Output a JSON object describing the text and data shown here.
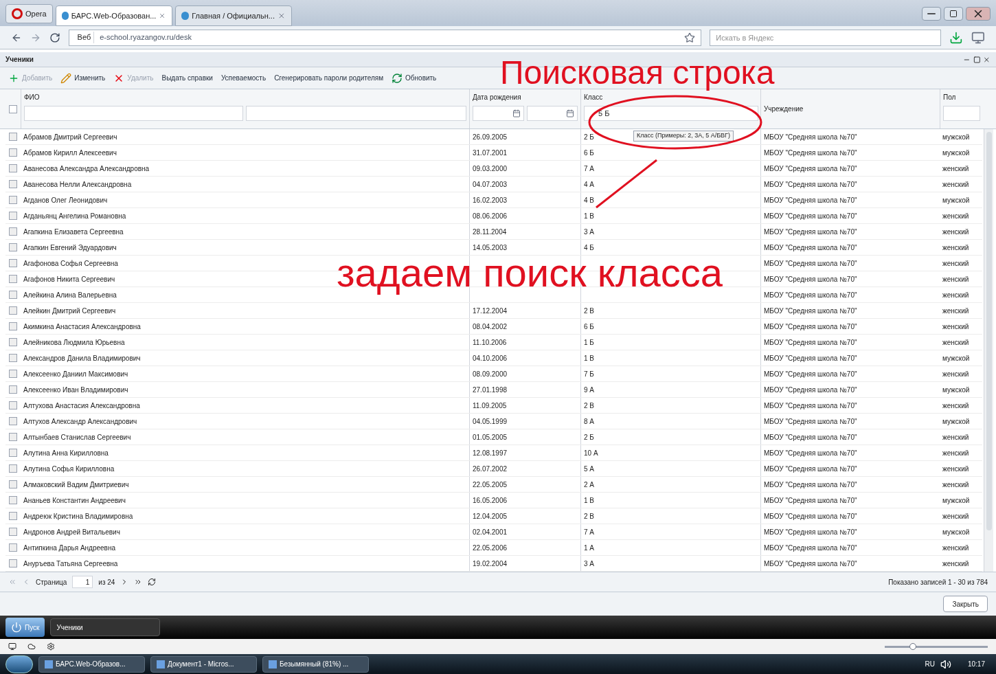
{
  "browser": {
    "menu_label": "Opera",
    "tabs": [
      {
        "label": "БАРС.Web-Образован...",
        "selected": true
      },
      {
        "label": "Главная / Официальн...",
        "selected": false
      }
    ],
    "address_badge": "Веб",
    "address": "e-school.ryazangov.ru/desk",
    "search_placeholder": "Искать в Яндекс"
  },
  "app": {
    "window_title": "Ученики",
    "toolbar": [
      {
        "label": "Добавить",
        "disabled": true,
        "kind": "add"
      },
      {
        "label": "Изменить",
        "disabled": false,
        "kind": "edit"
      },
      {
        "label": "Удалить",
        "disabled": true,
        "kind": "delete"
      },
      {
        "label": "Выдать справки",
        "disabled": false,
        "kind": "text"
      },
      {
        "label": "Успеваемость",
        "disabled": false,
        "kind": "text"
      },
      {
        "label": "Сгенерировать пароли родителям",
        "disabled": false,
        "kind": "text"
      },
      {
        "label": "Обновить",
        "disabled": false,
        "kind": "refresh"
      }
    ],
    "columns": [
      "ФИО",
      "Дата рождения",
      "Класс",
      "Учреждение",
      "Пол"
    ],
    "class_filter": "5 Б",
    "select_all": {
      "checked": false
    },
    "tooltip": "Класс (Примеры: 2, 3А, 5 А/БВГ)",
    "rows": [
      {
        "name": "Абрамов Дмитрий Сергеевич",
        "birth": "26.09.2005",
        "class": "2 Б",
        "school": "МБОУ \"Средняя школа №70\"",
        "sex": "мужской",
        "checked": false
      },
      {
        "name": "Абрамов Кирилл Алексеевич",
        "birth": "31.07.2001",
        "class": "6 Б",
        "school": "МБОУ \"Средняя школа №70\"",
        "sex": "мужской",
        "checked": false
      },
      {
        "name": "Аванесова Александра Александровна",
        "birth": "09.03.2000",
        "class": "7 А",
        "school": "МБОУ \"Средняя школа №70\"",
        "sex": "женский",
        "checked": false
      },
      {
        "name": "Аванесова Нелли Александровна",
        "birth": "04.07.2003",
        "class": "4 А",
        "school": "МБОУ \"Средняя школа №70\"",
        "sex": "женский",
        "checked": false
      },
      {
        "name": "Агданов Олег Леонидович",
        "birth": "16.02.2003",
        "class": "4 В",
        "school": "МБОУ \"Средняя школа №70\"",
        "sex": "мужской",
        "checked": false
      },
      {
        "name": "Агданьянц Ангелина Романовна",
        "birth": "08.06.2006",
        "class": "1 В",
        "school": "МБОУ \"Средняя школа №70\"",
        "sex": "женский",
        "checked": false
      },
      {
        "name": "Агапкина Елизавета Сергеевна",
        "birth": "28.11.2004",
        "class": "3 А",
        "school": "МБОУ \"Средняя школа №70\"",
        "sex": "женский",
        "checked": false
      },
      {
        "name": "Агапкин Евгений Эдуардович",
        "birth": "14.05.2003",
        "class": "4 Б",
        "school": "МБОУ \"Средняя школа №70\"",
        "sex": "женский",
        "checked": false
      },
      {
        "name": "Агафонова Софья Сергеевна",
        "school": "МБОУ \"Средняя школа №70\"",
        "sex": "женский",
        "checked": false
      },
      {
        "name": "Агафонов Никита Сергеевич",
        "school": "МБОУ \"Средняя школа №70\"",
        "sex": "женский",
        "checked": false
      },
      {
        "name": "Алейкина Алина Валерьевна",
        "school": "МБОУ \"Средняя школа №70\"",
        "sex": "женский",
        "checked": false
      },
      {
        "name": "Алейкин Дмитрий Сергеевич",
        "birth": "17.12.2004",
        "class": "2 В",
        "school": "МБОУ \"Средняя школа №70\"",
        "sex": "женский",
        "checked": false
      },
      {
        "name": "Акимкина Анастасия Александровна",
        "birth": "08.04.2002",
        "class": "6 Б",
        "school": "МБОУ \"Средняя школа №70\"",
        "sex": "женский",
        "checked": false
      },
      {
        "name": "Алейникова Людмила Юрьевна",
        "birth": "11.10.2006",
        "class": "1 Б",
        "school": "МБОУ \"Средняя школа №70\"",
        "sex": "женский",
        "checked": false
      },
      {
        "name": "Александров Данила Владимирович",
        "birth": "04.10.2006",
        "class": "1 В",
        "school": "МБОУ \"Средняя школа №70\"",
        "sex": "мужской",
        "checked": false
      },
      {
        "name": "Алексеенко Даниил Максимович",
        "birth": "08.09.2000",
        "class": "7 Б",
        "school": "МБОУ \"Средняя школа №70\"",
        "sex": "женский",
        "checked": false
      },
      {
        "name": "Алексеенко Иван Владимирович",
        "birth": "27.01.1998",
        "class": "9 А",
        "school": "МБОУ \"Средняя школа №70\"",
        "sex": "мужской",
        "checked": false
      },
      {
        "name": "Алтухова Анастасия Александровна",
        "birth": "11.09.2005",
        "class": "2 В",
        "school": "МБОУ \"Средняя школа №70\"",
        "sex": "женский",
        "checked": false
      },
      {
        "name": "Алтухов Александр Александрович",
        "birth": "04.05.1999",
        "class": "8 А",
        "school": "МБОУ \"Средняя школа №70\"",
        "sex": "мужской",
        "checked": false
      },
      {
        "name": "Алтынбаев Станислав Сергеевич",
        "birth": "01.05.2005",
        "class": "2 Б",
        "school": "МБОУ \"Средняя школа №70\"",
        "sex": "женский",
        "checked": false
      },
      {
        "name": "Алутина Анна Кирилловна",
        "birth": "12.08.1997",
        "class": "10 А",
        "school": "МБОУ \"Средняя школа №70\"",
        "sex": "женский",
        "checked": false
      },
      {
        "name": "Алутина Софья Кирилловна",
        "birth": "26.07.2002",
        "class": "5 А",
        "school": "МБОУ \"Средняя школа №70\"",
        "sex": "женский",
        "checked": false
      },
      {
        "name": "Алмаковский Вадим Дмитриевич",
        "birth": "22.05.2005",
        "class": "2 А",
        "school": "МБОУ \"Средняя школа №70\"",
        "sex": "женский",
        "checked": false
      },
      {
        "name": "Ананьев Константин Андреевич",
        "birth": "16.05.2006",
        "class": "1 В",
        "school": "МБОУ \"Средняя школа №70\"",
        "sex": "мужской",
        "checked": false
      },
      {
        "name": "Андреюк Кристина Владимировна",
        "birth": "12.04.2005",
        "class": "2 В",
        "school": "МБОУ \"Средняя школа №70\"",
        "sex": "женский",
        "checked": false
      },
      {
        "name": "Андронов Андрей Витальевич",
        "birth": "02.04.2001",
        "class": "7 А",
        "school": "МБОУ \"Средняя школа №70\"",
        "sex": "мужской",
        "checked": false
      },
      {
        "name": "Антипкина Дарья Андреевна",
        "birth": "22.05.2006",
        "class": "1 А",
        "school": "МБОУ \"Средняя школа №70\"",
        "sex": "женский",
        "checked": false
      },
      {
        "name": "Ануръева Татьяна Сергеевна",
        "birth": "19.02.2004",
        "class": "3 А",
        "school": "МБОУ \"Средняя школа №70\"",
        "sex": "женский",
        "checked": false
      }
    ],
    "pager": {
      "page_label": "Страница",
      "page": "1",
      "of": "из 24"
    },
    "status": "Показано записей 1 - 30 из 784",
    "close_button": "Закрыть",
    "app_taskbar": {
      "start": "Пуск",
      "windows": [
        "Ученики"
      ]
    }
  },
  "zoom": {
    "level": 0.27
  },
  "taskbar": {
    "windows": [
      "БАРС.Web-Образов...",
      "Документ1 - Micros...",
      "Безымянный (81%) ..."
    ],
    "language": "RU",
    "time": "10:17"
  },
  "annotations": [
    "Поисковая строка",
    "задаем поиск класса"
  ]
}
